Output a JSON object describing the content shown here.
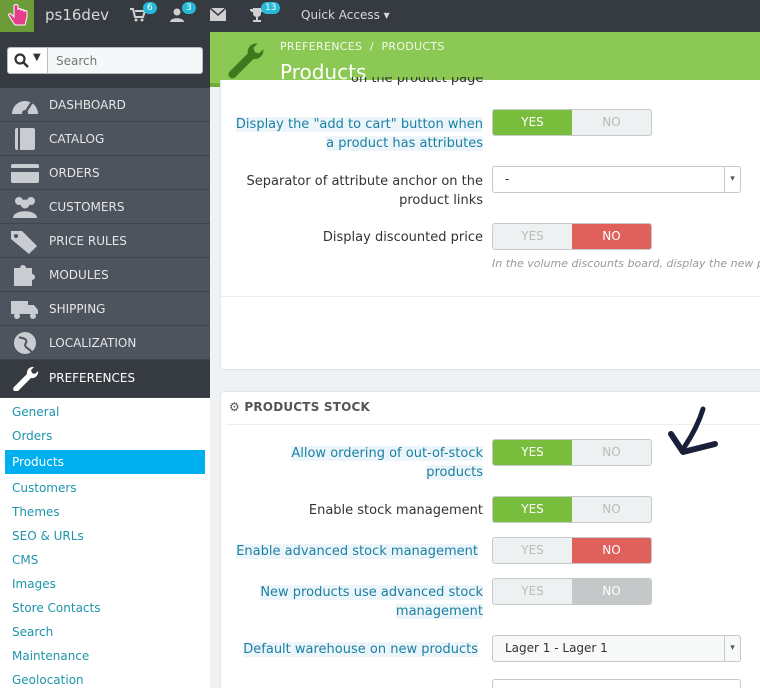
{
  "topbar": {
    "shop_name": "ps16dev",
    "cart_count": "6",
    "customers_count": "3",
    "trophy_count": "13",
    "quick_access": "Quick Access"
  },
  "sidebar": {
    "search_placeholder": "Search",
    "menu": [
      {
        "label": "DASHBOARD",
        "icon": "dashboard-icon"
      },
      {
        "label": "CATALOG",
        "icon": "book-icon"
      },
      {
        "label": "ORDERS",
        "icon": "credit-card-icon"
      },
      {
        "label": "CUSTOMERS",
        "icon": "users-icon"
      },
      {
        "label": "PRICE RULES",
        "icon": "tags-icon"
      },
      {
        "label": "MODULES",
        "icon": "puzzle-icon"
      },
      {
        "label": "SHIPPING",
        "icon": "truck-icon"
      },
      {
        "label": "LOCALIZATION",
        "icon": "globe-icon"
      },
      {
        "label": "PREFERENCES",
        "icon": "wrench-icon"
      }
    ],
    "submenu": [
      "General",
      "Orders",
      "Products",
      "Customers",
      "Themes",
      "SEO & URLs",
      "CMS",
      "Images",
      "Store Contacts",
      "Search",
      "Maintenance",
      "Geolocation"
    ]
  },
  "header": {
    "crumb1": "PREFERENCES",
    "crumb_sep": "/",
    "crumb2": "PRODUCTS",
    "title": "Products"
  },
  "panel1": {
    "partial_text": "on the product page",
    "add_to_cart_label_1": "Display the \"add to cart\" button when",
    "add_to_cart_label_2": "a product has attributes",
    "separator_label_1": "Separator of attribute anchor on the",
    "separator_label_2": "product links",
    "separator_value": "-",
    "discounted_label": "Display discounted price",
    "discounted_help": "In the volume discounts board, display the new p",
    "yes": "YES",
    "no": "NO"
  },
  "panel2": {
    "title": "PRODUCTS STOCK",
    "oos_label_1": "Allow ordering of out-of-stock",
    "oos_label_2": "products",
    "stock_mgmt_label": "Enable stock management",
    "adv_stock_label": "Enable advanced stock management",
    "new_adv_label_1": "New products use advanced stock",
    "new_adv_label_2": "management",
    "warehouse_label": "Default warehouse on new products",
    "warehouse_value": "Lager 1 - Lager 1",
    "yes": "YES",
    "no": "NO"
  },
  "colors": {
    "accent_green": "#79bd3c",
    "no_red": "#e0605c",
    "link_blue": "#1e94ab",
    "active_blue": "#00aff0"
  }
}
